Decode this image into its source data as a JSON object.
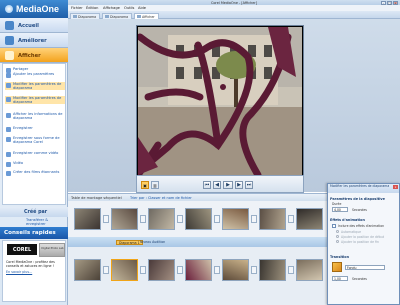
{
  "app": {
    "name": "MediaOne",
    "window_title": "Corel MediaOne - [Afficher]"
  },
  "sidebar": {
    "nav": [
      {
        "label": "Accueil",
        "icon": "home-icon"
      },
      {
        "label": "Améliorer",
        "icon": "enhance-icon"
      },
      {
        "label": "Afficher",
        "icon": "view-icon",
        "active": true
      }
    ],
    "tasks": [
      {
        "label": "Partager",
        "icon": "share-icon"
      },
      {
        "label": "Ajouter les paramètres",
        "icon": "settings-icon"
      },
      {
        "label": "Modifier les paramètres de diaporama",
        "icon": "slideshow-icon",
        "highlight": true
      },
      {
        "label": "Modifier les paramètres de diaporama",
        "icon": "slideshow-edit-icon",
        "highlight": true
      },
      {
        "label": "Afficher les informations de diaporama",
        "icon": "info-icon"
      },
      {
        "label": "Enregistrer",
        "icon": "save-icon"
      },
      {
        "label": "Enregistrer sous forme de diaporama Corel",
        "icon": "save-as-icon"
      },
      {
        "label": "Enregistrer comme vidéo",
        "icon": "video-save-icon"
      },
      {
        "label": "Vidéo",
        "icon": "video-icon"
      },
      {
        "label": "Créer des films étonnants",
        "icon": "film-icon"
      }
    ],
    "create": {
      "label": "Créé par",
      "sub": "Transférer & enregistrer"
    },
    "tips": {
      "title": "Conseils rapides",
      "brand": "COREL",
      "product": "Digital Photo Lab",
      "text": "Corel MediaOne : profitez des conseils et astuces en ligne !",
      "more": "En savoir plus..."
    }
  },
  "menubar": [
    "Fichier",
    "Édition",
    "Affichage",
    "Outils",
    "Aide"
  ],
  "tabs": [
    {
      "label": "Diaporama"
    },
    {
      "label": "Diaporama"
    },
    {
      "label": "Afficher",
      "active": true
    }
  ],
  "player": {
    "controls": [
      "first-icon",
      "prev-icon",
      "play-icon",
      "next-icon",
      "last-icon"
    ]
  },
  "storyboard": {
    "mode_label": "Table de montage séquentiel",
    "sort_label": "Trier par : Classer et nom de fichier",
    "tags": [
      "Diaporama 1",
      "Niveau Audition"
    ]
  },
  "properties": {
    "title": "Modifier les paramètres de diaporama",
    "close_symbol": "x",
    "sections": {
      "slide": "Paramètres de la diapositive",
      "duration_label": "Durée",
      "duration_value": "4,00",
      "duration_unit": "Secondes",
      "animation": "Effets d'animation",
      "animation_check": "Inclure des effets d'animation",
      "anim_opts": [
        "Automatique",
        "Ajouter la position de début",
        "Ajouter la position de fin"
      ],
      "transition": "Transition",
      "transition_value": "Fondu",
      "transition_duration": "1,00",
      "transition_unit": "Secondes"
    }
  },
  "colors": {
    "accent": "#f3a21c",
    "brand_blue": "#1f5fa9"
  }
}
